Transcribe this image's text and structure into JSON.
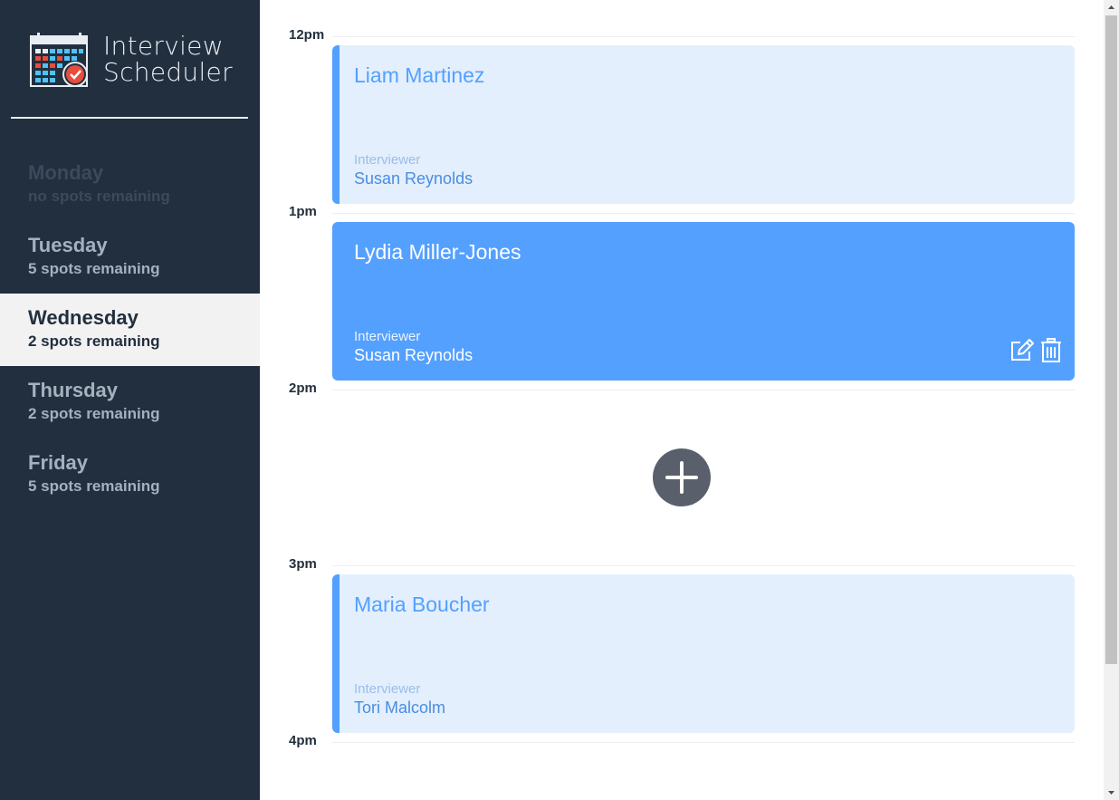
{
  "brand": {
    "title_line1": "Interview",
    "title_line2": "Scheduler",
    "logo_icon": "calendar-check-icon"
  },
  "sidebar": {
    "days": [
      {
        "name": "Monday",
        "spots": "no spots remaining",
        "state": "full"
      },
      {
        "name": "Tuesday",
        "spots": "5 spots remaining",
        "state": "normal"
      },
      {
        "name": "Wednesday",
        "spots": "2 spots remaining",
        "state": "selected"
      },
      {
        "name": "Thursday",
        "spots": "2 spots remaining",
        "state": "normal"
      },
      {
        "name": "Friday",
        "spots": "5 spots remaining",
        "state": "normal"
      }
    ]
  },
  "schedule": {
    "slots": [
      {
        "time": "12pm",
        "student": "Liam Martinez",
        "interviewer_label": "Interviewer",
        "interviewer": "Susan Reynolds"
      },
      {
        "time": "1pm",
        "student": "Lydia Miller-Jones",
        "interviewer_label": "Interviewer",
        "interviewer": "Susan Reynolds",
        "edit_icon": "edit-icon",
        "delete_icon": "trash-icon"
      },
      {
        "time": "2pm",
        "add_icon": "plus-icon"
      },
      {
        "time": "3pm",
        "student": "Maria Boucher",
        "interviewer_label": "Interviewer",
        "interviewer": "Tori Malcolm"
      },
      {
        "time": "4pm"
      }
    ]
  },
  "colors": {
    "sidebar_bg": "#222f3e",
    "accent": "#54a0ff",
    "card_light_bg": "#e3effd",
    "add_button": "#5a606b"
  }
}
